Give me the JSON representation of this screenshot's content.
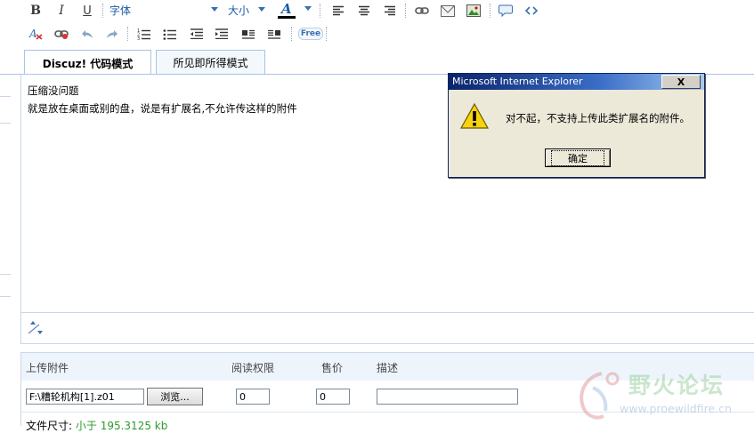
{
  "toolbar1": {
    "bold": "B",
    "italic": "I",
    "underline": "U",
    "font_label": "字体",
    "size_label": "大小",
    "font_color_letter": "A"
  },
  "toolbar2": {
    "free_label": "Free"
  },
  "tabs": [
    {
      "label": "Discuz! 代码模式",
      "active": true
    },
    {
      "label": "所见即所得模式",
      "active": false
    }
  ],
  "editor": {
    "lines": [
      "压缩没问题",
      "就是放在桌面或别的盘，说是有扩展名,不允许传这样的附件"
    ]
  },
  "attachments": {
    "headers": {
      "file": "上传附件",
      "permission": "阅读权限",
      "price": "售价",
      "description": "描述"
    },
    "row": {
      "path": "F:\\糟轮机构[1].z01",
      "browse": "浏览...",
      "permission": "0",
      "price": "0",
      "description": ""
    },
    "footer_label": "文件尺寸:",
    "footer_value": "小于 195.3125 kb"
  },
  "dialog": {
    "title": "Microsoft Internet Explorer",
    "close": "X",
    "message": "对不起，不支持上传此类扩展名的附件。",
    "ok": "确定"
  },
  "watermark": {
    "text": "野火论坛",
    "url": "www.proewildfire.cn"
  },
  "colors": {
    "accent_border": "#a9c4e4",
    "titlebar": "#0a246a",
    "dialog_bg": "#ece9d8",
    "link_blue": "#1a5ca8",
    "green_footer": "#2e9b2e"
  }
}
